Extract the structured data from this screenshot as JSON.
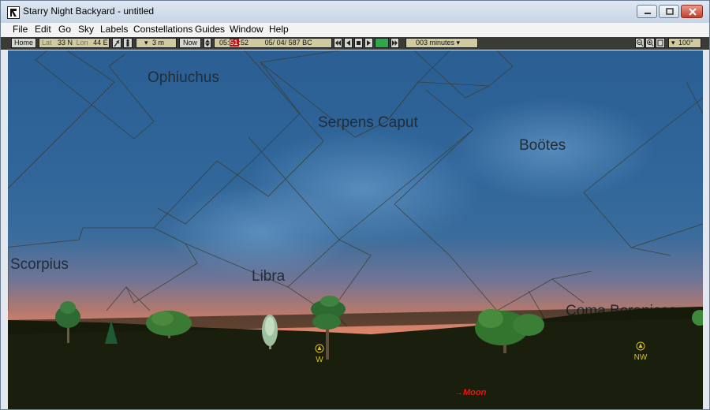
{
  "window": {
    "title": "Starry Night Backyard - untitled"
  },
  "menu": [
    "File",
    "Edit",
    "Go",
    "Sky",
    "Labels",
    "Constellations",
    "Guides",
    "Window",
    "Help"
  ],
  "toolbar": {
    "home": "Home",
    "lat_label": "Lat",
    "lat_value": "33 N",
    "lon_label": "Lon",
    "lon_value": "44 E",
    "elevation": "3 m",
    "now": "Now",
    "time_h": "05:",
    "time_m": "51",
    "time_s": ":52",
    "date": "05/ 04/ 587 BC",
    "step": "003 minutes",
    "fov": "100°"
  },
  "sky": {
    "constellations": [
      "Ophiuchus",
      "Serpens Caput",
      "Boötes",
      "Scorpius",
      "Libra",
      "Coma Berenices"
    ],
    "directions": [
      "W",
      "NW"
    ],
    "moon_label": "Moon"
  },
  "colors": {
    "sky_top": "#2b5f93",
    "horizon": "#e08a6c",
    "ground": "#1a1e0d",
    "toolbar": "#3a3a36",
    "compass": "#d8c020",
    "moon": "#e11a10"
  }
}
